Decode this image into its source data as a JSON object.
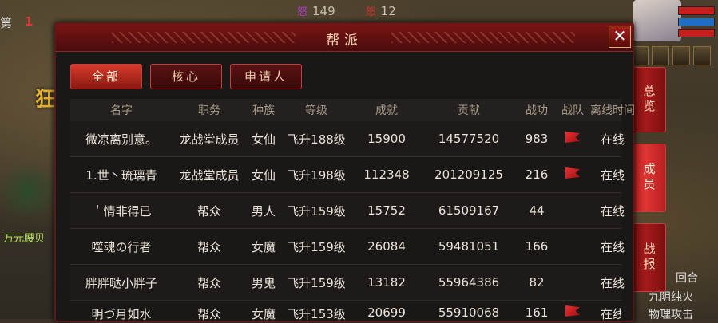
{
  "background": {
    "top_left_label": "第",
    "top_left_number": "1",
    "left_character": "狂",
    "left_name": "万元腰贝",
    "top_stats": [
      {
        "glyph": "怒",
        "value": "149"
      },
      {
        "glyph": "怒",
        "value": "12"
      }
    ],
    "right_texts": [
      "回合",
      "九阴纯火",
      "物理攻击"
    ]
  },
  "panel": {
    "title": "帮派",
    "close_label": "✕",
    "tabs": [
      {
        "label": "全部",
        "active": true
      },
      {
        "label": "核心",
        "active": false
      },
      {
        "label": "申请人",
        "active": false
      }
    ],
    "columns": [
      "名字",
      "职务",
      "种族",
      "等级",
      "成就",
      "贡献",
      "战功",
      "战队",
      "离线时间"
    ],
    "rows": [
      {
        "name": "微凉离别意。",
        "role": "龙战堂成员",
        "race": "女仙",
        "level": "飞升188级",
        "achievement": "15900",
        "contribution": "14577520",
        "merit": "983",
        "team_flag": true,
        "offline": "在线"
      },
      {
        "name": "1.世丶琉璃青",
        "role": "龙战堂成员",
        "race": "女仙",
        "level": "飞升198级",
        "achievement": "112348",
        "contribution": "201209125",
        "merit": "216",
        "team_flag": true,
        "offline": "在线"
      },
      {
        "name": "＇情非得已",
        "role": "帮众",
        "race": "男人",
        "level": "飞升159级",
        "achievement": "15752",
        "contribution": "61509167",
        "merit": "44",
        "team_flag": false,
        "offline": "在线"
      },
      {
        "name": "噬魂の行者",
        "role": "帮众",
        "race": "女魔",
        "level": "飞升159级",
        "achievement": "26084",
        "contribution": "59481051",
        "merit": "166",
        "team_flag": false,
        "offline": "在线"
      },
      {
        "name": "胖胖哒小胖子",
        "role": "帮众",
        "race": "男鬼",
        "level": "飞升159级",
        "achievement": "13182",
        "contribution": "55964386",
        "merit": "82",
        "team_flag": false,
        "offline": "在线"
      },
      {
        "name": "明づ月如水",
        "role": "帮众",
        "race": "女魔",
        "level": "飞升153级",
        "achievement": "20699",
        "contribution": "55910068",
        "merit": "161",
        "team_flag": true,
        "offline": "在线"
      }
    ]
  },
  "side_tabs": [
    {
      "label": "总览",
      "active": false
    },
    {
      "label": "成员",
      "active": true
    },
    {
      "label": "战报",
      "active": false
    }
  ]
}
